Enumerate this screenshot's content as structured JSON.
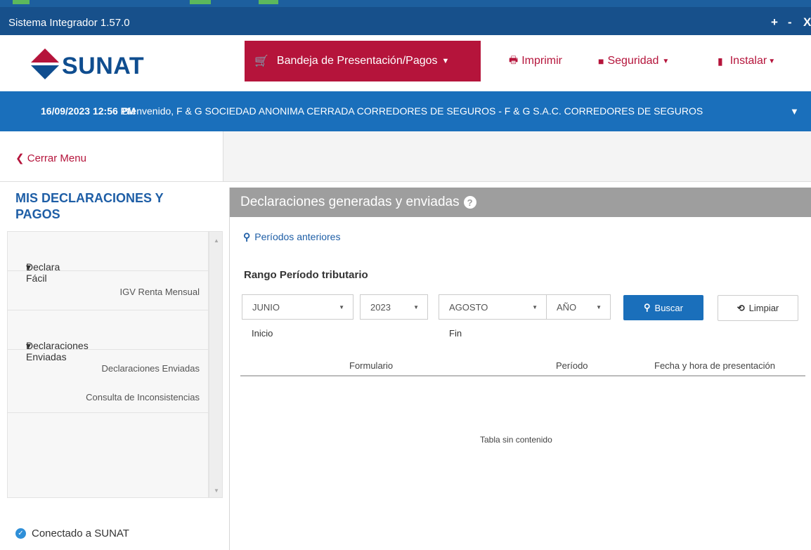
{
  "window": {
    "title": "Sistema Integrador 1.57.0",
    "controls": [
      "+",
      "-",
      "X"
    ]
  },
  "header": {
    "logo_text": "SUNAT",
    "nav": {
      "bandeja": "Bandeja de Presentación/Pagos",
      "imprimir": "Imprimir",
      "seguridad": "Seguridad",
      "instalar": "Instalar"
    }
  },
  "userbar": {
    "datetime": "16/09/2023 12:56 PM",
    "company": "Bienvenido, F & G SOCIEDAD ANONIMA CERRADA CORREDORES DE SEGUROS -  F & G S.A.C. CORREDORES DE SEGUROS"
  },
  "sidebar": {
    "close_menu": "Cerrar Menu",
    "heading": "MIS DECLARACIONES Y PAGOS",
    "groups": [
      {
        "label": "Declara Fácil",
        "items": [
          "IGV Renta Mensual"
        ]
      },
      {
        "label": "Declaraciones Enviadas",
        "items": [
          "Declaraciones Enviadas",
          "Consulta de Inconsistencias"
        ]
      }
    ],
    "status": "Conectado a SUNAT"
  },
  "main": {
    "panel_title": "Declaraciones generadas y enviadas",
    "periodos_link": "Períodos anteriores",
    "range_title": "Rango Período tributario",
    "inicio": {
      "month": "JUNIO",
      "year": "2023",
      "label": "Inicio"
    },
    "fin": {
      "month": "AGOSTO",
      "year": "AÑO",
      "label": "Fin"
    },
    "buscar": "Buscar",
    "limpiar": "Limpiar",
    "table": {
      "columns": [
        "Formulario",
        "Período",
        "Fecha y hora de presentación"
      ],
      "empty": "Tabla sin contenido"
    }
  },
  "colors": {
    "brand_blue": "#17508b",
    "bar_blue": "#1a6fbb",
    "accent_red": "#b5143b",
    "panel_gray": "#9e9e9e"
  }
}
